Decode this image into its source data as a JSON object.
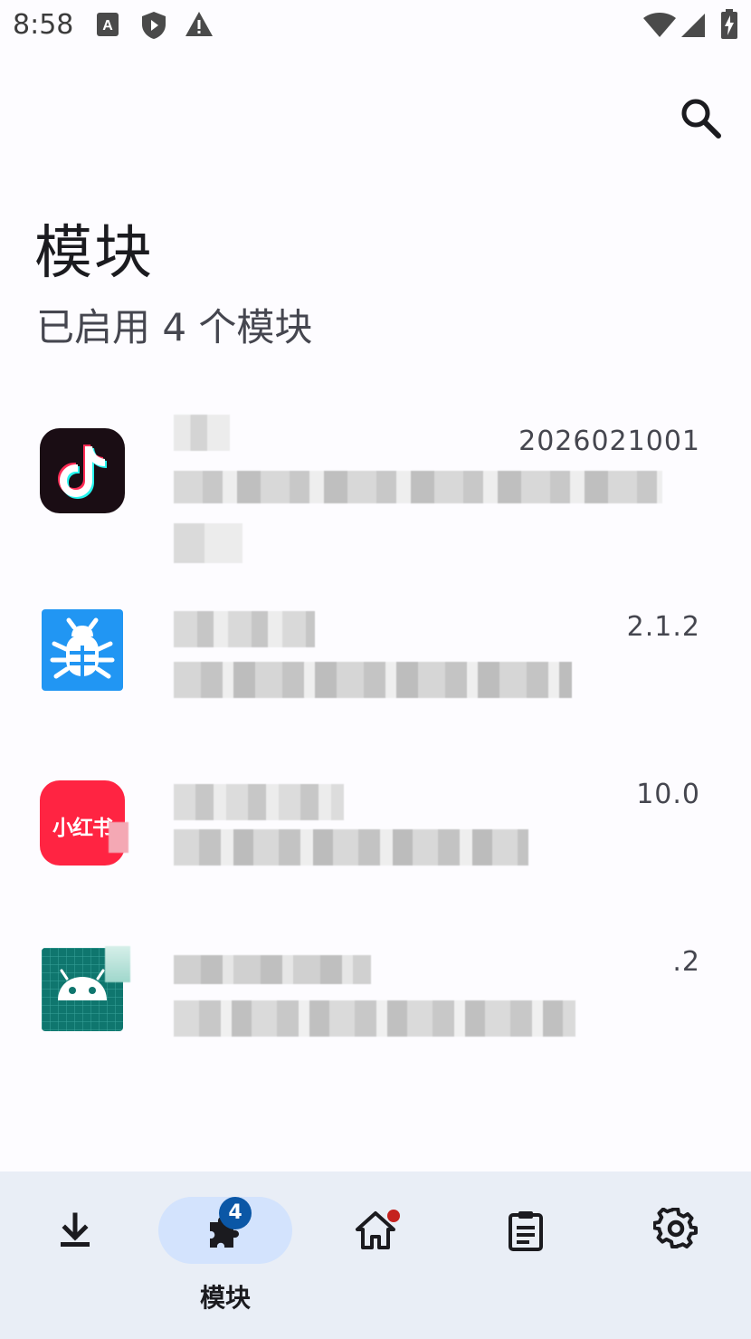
{
  "status_bar": {
    "time": "8:58"
  },
  "header": {
    "search_icon": "search-icon"
  },
  "page": {
    "title": "模块",
    "subtitle": "已启用 4 个模块"
  },
  "modules": [
    {
      "icon": "tiktok-icon",
      "version": "2026021001",
      "accent": "#ff2d55"
    },
    {
      "icon": "bug-icon",
      "version": "2.1.2",
      "accent": "#2196f3"
    },
    {
      "icon": "xiaohongshu-icon",
      "icon_text": "小红书",
      "version": "10.0",
      "accent": "#ff2442"
    },
    {
      "icon": "android-icon",
      "version": ".2",
      "accent": "#0f766e"
    }
  ],
  "nav": {
    "items": [
      {
        "id": "download",
        "icon": "download-icon"
      },
      {
        "id": "modules",
        "icon": "puzzle-icon",
        "label": "模块",
        "badge": "4",
        "selected": true
      },
      {
        "id": "home",
        "icon": "home-icon",
        "has_dot": true
      },
      {
        "id": "logs",
        "icon": "clipboard-icon"
      },
      {
        "id": "settings",
        "icon": "gear-icon"
      }
    ]
  },
  "colors": {
    "background": "#fdfcff",
    "nav_background": "#e9eef6",
    "nav_pill": "#d3e3fd",
    "badge": "#0b57a6",
    "notification_dot": "#c5221f"
  }
}
